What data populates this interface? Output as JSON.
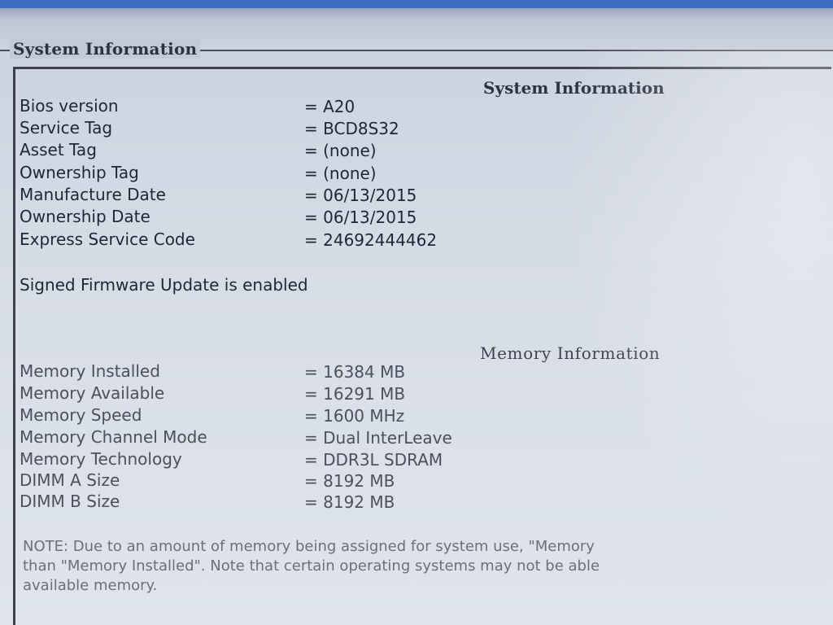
{
  "window": {
    "group_title": "System Information"
  },
  "system": {
    "heading": "System Information",
    "rows": [
      {
        "label": "Bios version",
        "value": "= A20"
      },
      {
        "label": "Service Tag",
        "value": "= BCD8S32"
      },
      {
        "label": "Asset Tag",
        "value": "= (none)"
      },
      {
        "label": "Ownership Tag",
        "value": "= (none)"
      },
      {
        "label": "Manufacture Date",
        "value": "= 06/13/2015"
      },
      {
        "label": "Ownership Date",
        "value": "= 06/13/2015"
      },
      {
        "label": "Express Service Code",
        "value": "= 24692444462"
      }
    ],
    "firmware_status": "Signed Firmware Update is enabled"
  },
  "memory": {
    "heading": "Memory Information",
    "rows": [
      {
        "label": "Memory Installed",
        "value": "= 16384 MB"
      },
      {
        "label": "Memory Available",
        "value": "= 16291 MB"
      },
      {
        "label": "Memory Speed",
        "value": "= 1600 MHz"
      },
      {
        "label": "Memory Channel Mode",
        "value": "= Dual InterLeave"
      },
      {
        "label": "Memory Technology",
        "value": "= DDR3L SDRAM"
      },
      {
        "label": "DIMM A Size",
        "value": "= 8192 MB"
      },
      {
        "label": "DIMM B Size",
        "value": "= 8192 MB"
      }
    ],
    "note_lines": [
      "NOTE: Due to an amount of memory being assigned for system use, \"Memory",
      "than \"Memory Installed\". Note that certain operating systems may not be able",
      "available memory."
    ]
  }
}
